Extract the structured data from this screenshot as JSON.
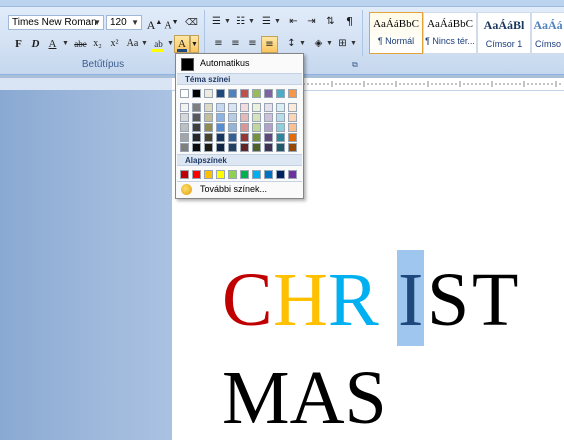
{
  "ribbon": {
    "font_name": "Times New Roman",
    "font_size": "120",
    "group_label": "Betűtípus",
    "buttons": {
      "bold": "F",
      "italic": "D",
      "underline": "A",
      "strike": "abe",
      "subscript": "x₂",
      "superscript": "x²",
      "change_case": "Aa",
      "grow_font": "A",
      "shrink_font": "A",
      "highlight": "ab",
      "font_color": "A"
    },
    "styles": [
      {
        "sample": "AaÁáBbC",
        "name": "¶ Normál"
      },
      {
        "sample": "AaÁáBbC",
        "name": "¶ Nincs tér..."
      },
      {
        "sample": "AaÁáBl",
        "name": "Címsor 1"
      },
      {
        "sample": "AaÁá",
        "name": "Címso"
      }
    ]
  },
  "color_menu": {
    "automatic_label": "Automatikus",
    "theme_header": "Téma színei",
    "standard_header": "Alapszínek",
    "more_label": "További színek...",
    "theme_top_row": [
      "#ffffff",
      "#000000",
      "#eeece1",
      "#1f497d",
      "#4f81bd",
      "#c0504d",
      "#9bbb59",
      "#8064a2",
      "#4bacc6",
      "#f79646"
    ],
    "theme_shades": [
      [
        "#f2f2f2",
        "#7f7f7f",
        "#ddd9c3",
        "#c6d9f0",
        "#dbe5f1",
        "#f2dcdb",
        "#ebf1dd",
        "#e5e0ec",
        "#dbeef3",
        "#fdeada"
      ],
      [
        "#d8d8d8",
        "#595959",
        "#c4bd97",
        "#8db3e2",
        "#b8cce4",
        "#e5b9b7",
        "#d7e3bc",
        "#ccc1d9",
        "#b7dde8",
        "#fbd5b5"
      ],
      [
        "#bfbfbf",
        "#3f3f3f",
        "#938953",
        "#548dd4",
        "#95b3d7",
        "#d99694",
        "#c3d69b",
        "#b2a2c7",
        "#92cddc",
        "#fac08f"
      ],
      [
        "#a5a5a5",
        "#262626",
        "#494429",
        "#17365d",
        "#366092",
        "#953734",
        "#76923c",
        "#5f497a",
        "#31859b",
        "#e36c09"
      ],
      [
        "#7f7f7f",
        "#0c0c0c",
        "#1d1b10",
        "#0f243e",
        "#244061",
        "#632423",
        "#4f6128",
        "#3f3151",
        "#205867",
        "#974806"
      ]
    ],
    "standard_colors": [
      "#c00000",
      "#ff0000",
      "#ffc000",
      "#ffff00",
      "#92d050",
      "#00b050",
      "#00b0f0",
      "#0070c0",
      "#002060",
      "#7030a0"
    ]
  },
  "document": {
    "letters": [
      {
        "ch": "C",
        "color": "#c00000"
      },
      {
        "ch": "H",
        "color": "#ffc000"
      },
      {
        "ch": "R",
        "color": "#00b0f0"
      },
      {
        "ch": "I",
        "color": "#1f497d"
      },
      {
        "ch": "S",
        "color": "#000000"
      },
      {
        "ch": "T",
        "color": "#000000"
      }
    ],
    "line2": "MAS"
  }
}
